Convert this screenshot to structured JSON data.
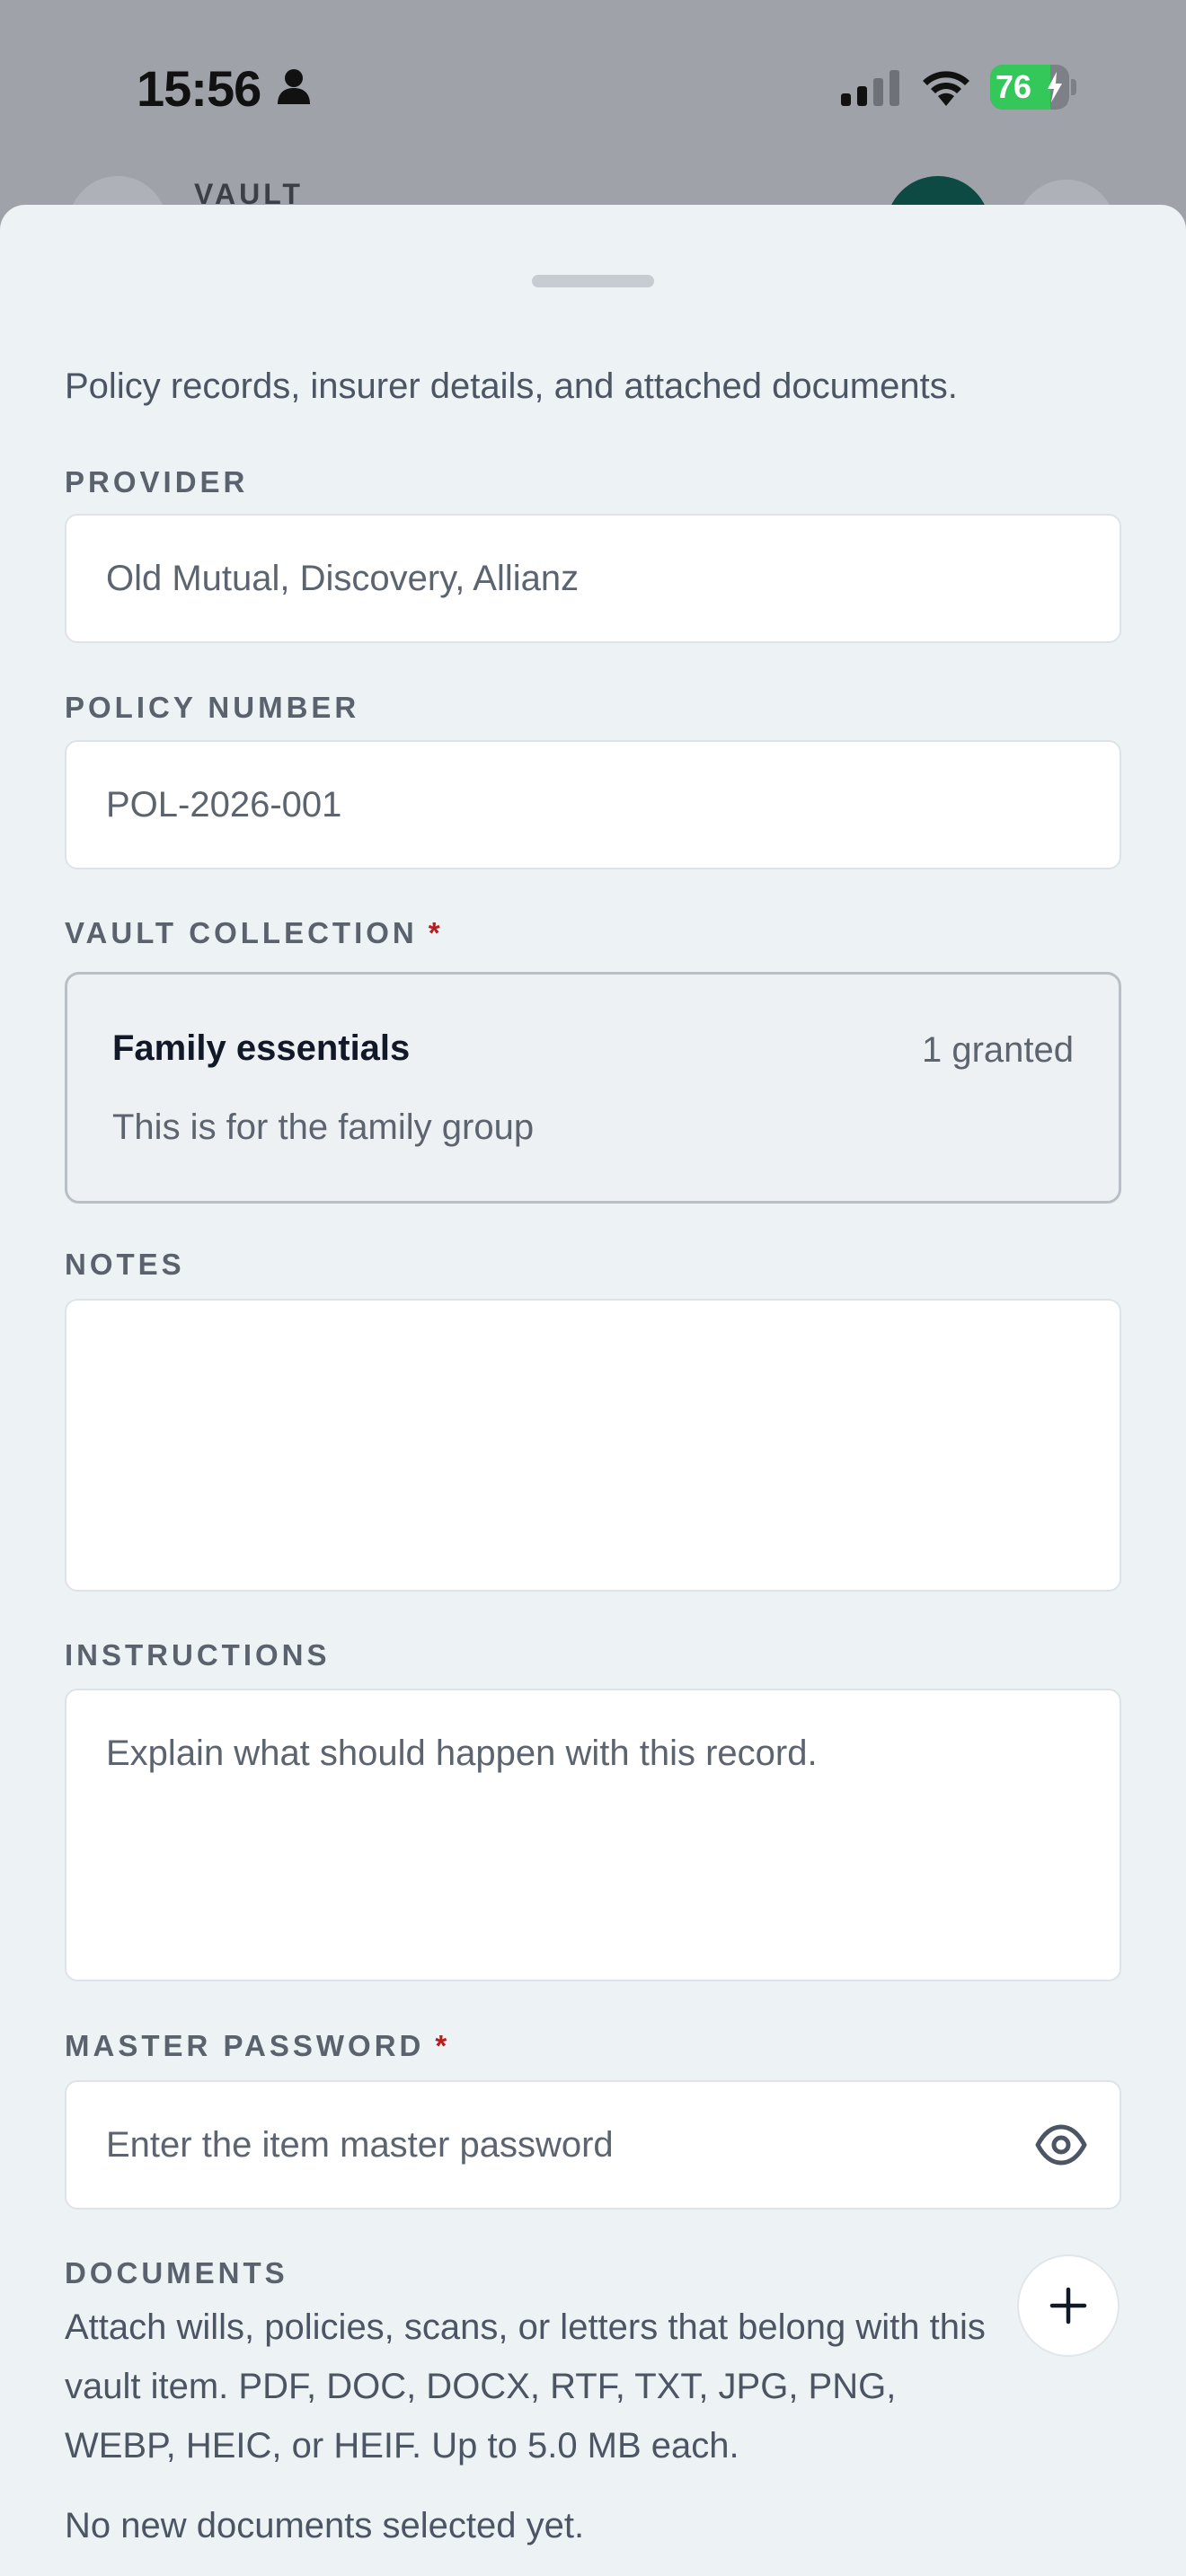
{
  "status_bar": {
    "time": "15:56",
    "battery_level": "76",
    "battery_fraction": 0.76,
    "icons": [
      "person-icon",
      "signal-icon",
      "wifi-icon",
      "battery-charging-icon"
    ]
  },
  "background": {
    "title": "VAULT"
  },
  "sheet": {
    "description": "Policy records, insurer details, and attached documents.",
    "provider": {
      "label": "PROVIDER",
      "placeholder": "Old Mutual, Discovery, Allianz"
    },
    "policy_number": {
      "label": "POLICY NUMBER",
      "placeholder": "POL-2026-001"
    },
    "vault_collection": {
      "label": "VAULT COLLECTION",
      "required_mark": "*",
      "selected": {
        "name": "Family essentials",
        "count": "1 granted",
        "description": "This is for the family group"
      }
    },
    "notes": {
      "label": "NOTES",
      "value": ""
    },
    "instructions": {
      "label": "INSTRUCTIONS",
      "placeholder": "Explain what should happen with this record."
    },
    "master_password": {
      "label": "MASTER PASSWORD",
      "required_mark": "*",
      "placeholder": "Enter the item master password",
      "icon": "eye-icon"
    },
    "documents": {
      "label": "DOCUMENTS",
      "help": "Attach wills, policies, scans, or letters that belong with this vault item. PDF, DOC, DOCX, RTF, TXT, JPG, PNG, WEBP, HEIC, or HEIF. Up to 5.0 MB each.",
      "empty": "No new documents selected yet.",
      "add_icon": "plus-icon"
    }
  },
  "colors": {
    "accent_teal": "#0d4a44",
    "required_red": "#b91c1c",
    "battery_green": "#34c759"
  }
}
